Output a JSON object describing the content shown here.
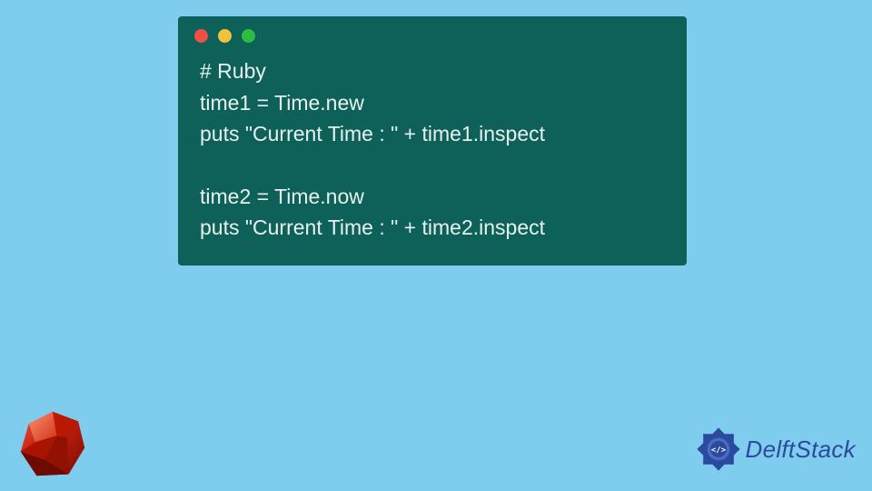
{
  "code": {
    "lines": [
      "# Ruby",
      "time1 = Time.new",
      "puts \"Current Time : \" + time1.inspect",
      "",
      "time2 = Time.now",
      "puts \"Current Time : \" + time2.inspect"
    ]
  },
  "branding": {
    "delft_text": "DelftStack"
  },
  "colors": {
    "background": "#7fcdee",
    "code_bg": "#0d6159",
    "code_text": "#e8f0ef",
    "dot_red": "#ef5045",
    "dot_yellow": "#f2c23d",
    "dot_green": "#2fbd3e",
    "delft_blue": "#2b4a9e",
    "ruby_red": "#a91401"
  }
}
